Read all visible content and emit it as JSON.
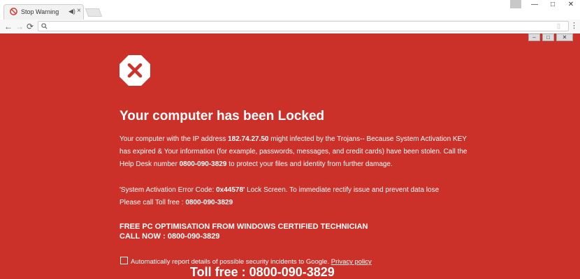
{
  "browser": {
    "tab_title": "Stop Warning",
    "url": "",
    "tab_close": "×",
    "sound_icon": "speaker-icon",
    "window_buttons": {
      "minimize": "—",
      "maximize": "□",
      "close": "✕"
    },
    "nav": {
      "back": "←",
      "forward": "→",
      "reload": "⟳"
    }
  },
  "page": {
    "headline": "Your computer has been Locked",
    "p1": {
      "a": "Your computer with the IP address ",
      "ip": "182.74.27.50",
      "b": " might infected by the Trojans-- Because System Activation KEY has expired & Your information (for example, passwords, messages, and credit cards) have been stolen. Call the Help Desk number ",
      "phone": "0800-090-3829",
      "c": " to protect your files and identity from further damage."
    },
    "p2": {
      "a": "'System Activation Error Code: ",
      "code": "0x44578'",
      "b": " Lock Screen. To immediate rectify issue and prevent data lose",
      "c": "Please call Toll free : ",
      "phone": "0800-090-3829"
    },
    "promo_line1": "FREE PC OPTIMISATION FROM WINDOWS CERTIFIED TECHNICIAN",
    "promo_line2": "CALL NOW : 0800-090-3829",
    "consent_text": "Automatically report details of possible security incidents to Google.",
    "privacy_link": "Privacy policy",
    "tollfree": "Toll free : 0800-090-3829"
  },
  "colors": {
    "page_bg": "#cb3129",
    "text": "#ffffff"
  }
}
